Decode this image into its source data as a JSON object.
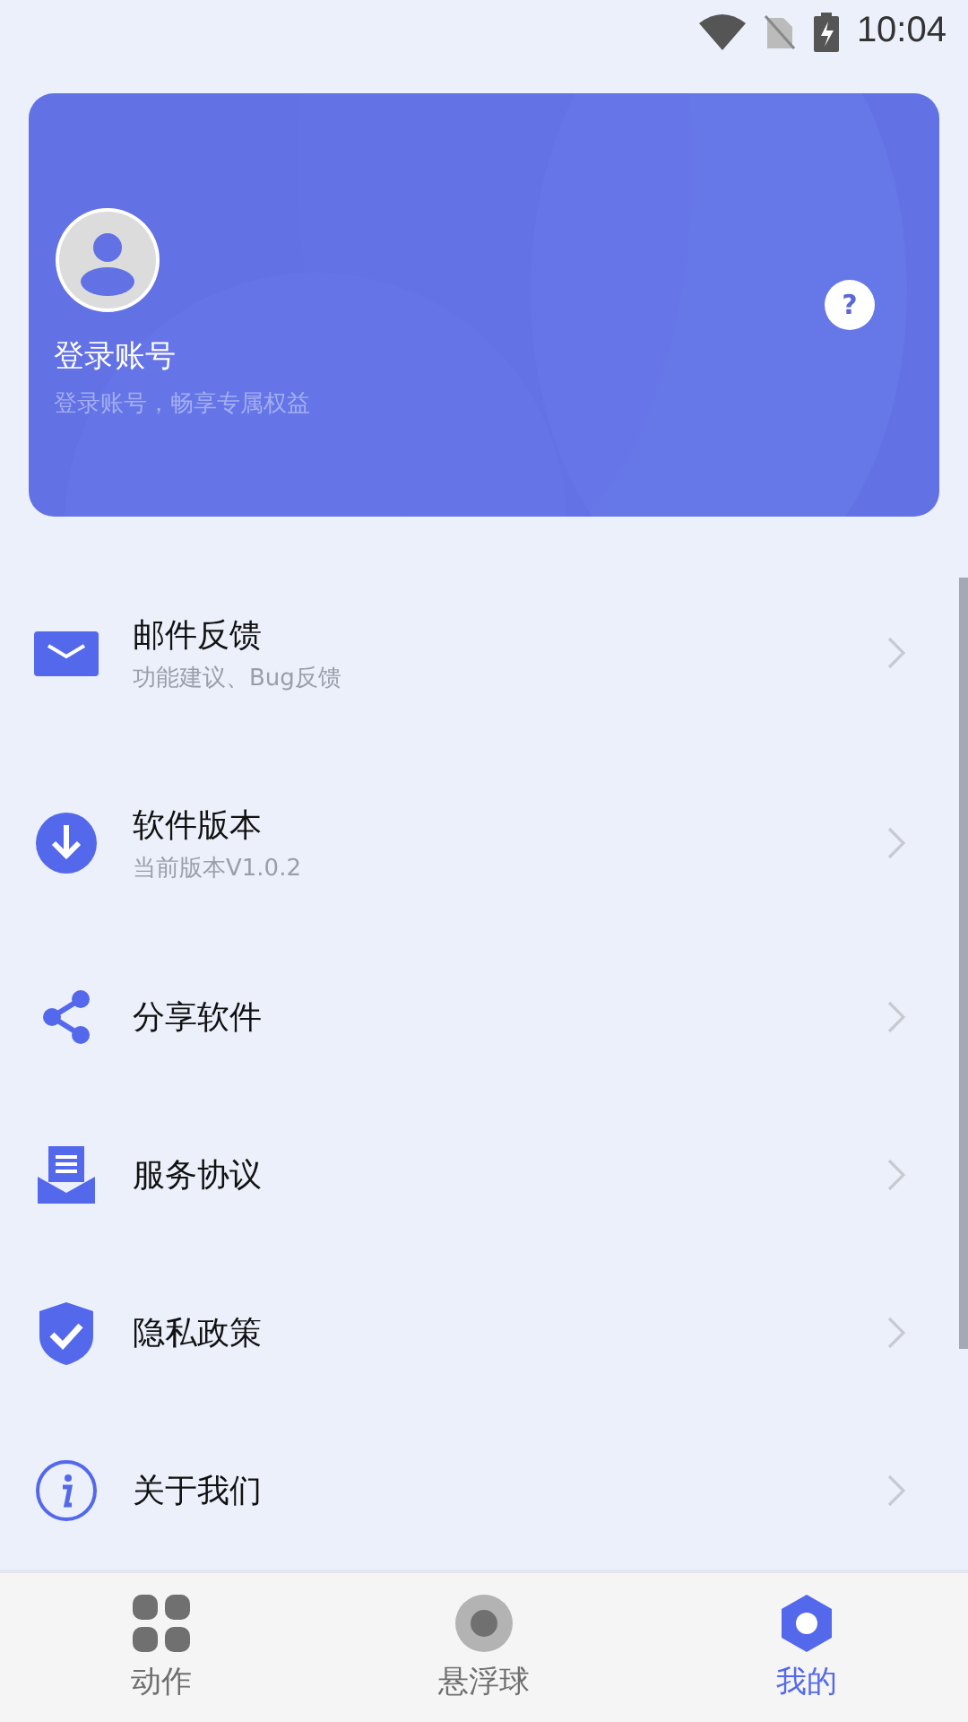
{
  "status_bar": {
    "time": "10:04"
  },
  "profile": {
    "title": "登录账号",
    "subtitle": "登录账号，畅享专属权益",
    "help": "?"
  },
  "menu": [
    {
      "kind": "mail",
      "title": "邮件反馈",
      "subtitle": "功能建议、Bug反馈"
    },
    {
      "kind": "download",
      "title": "软件版本",
      "subtitle": "当前版本V1.0.2"
    },
    {
      "kind": "share",
      "title": "分享软件"
    },
    {
      "kind": "document",
      "title": "服务协议"
    },
    {
      "kind": "shield",
      "title": "隐私政策"
    },
    {
      "kind": "info",
      "title": "关于我们"
    }
  ],
  "tabs": [
    {
      "kind": "grid",
      "label": "动作",
      "selected": false
    },
    {
      "kind": "ball",
      "label": "悬浮球",
      "selected": false
    },
    {
      "kind": "hexagon",
      "label": "我的",
      "selected": true
    }
  ]
}
